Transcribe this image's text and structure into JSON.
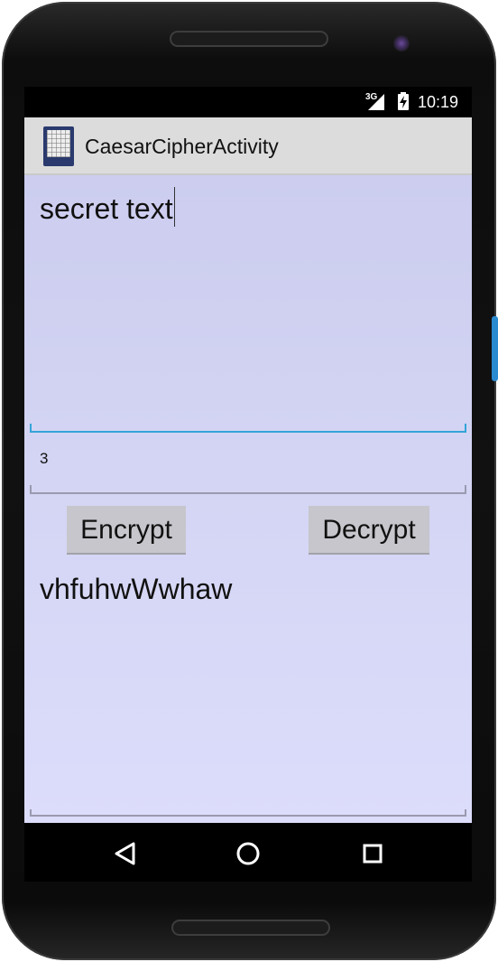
{
  "status_bar": {
    "network_label": "3G",
    "time": "10:19",
    "icons": [
      "signal-icon",
      "battery-charging-icon"
    ]
  },
  "action_bar": {
    "title": "CaesarCipherActivity",
    "icon": "app-icon"
  },
  "form": {
    "plaintext_value": "secret text",
    "shift_value": "3",
    "encrypt_label": "Encrypt",
    "decrypt_label": "Decrypt",
    "output_value": "vhfuhwWwhaw"
  },
  "navigation": {
    "icons": [
      "back-icon",
      "home-icon",
      "recent-apps-icon"
    ]
  },
  "colors": {
    "accent": "#33a4d8",
    "action_bar": "#dcdcdc",
    "content_background": "#d3d4f3",
    "button": "#c6c6cc"
  }
}
